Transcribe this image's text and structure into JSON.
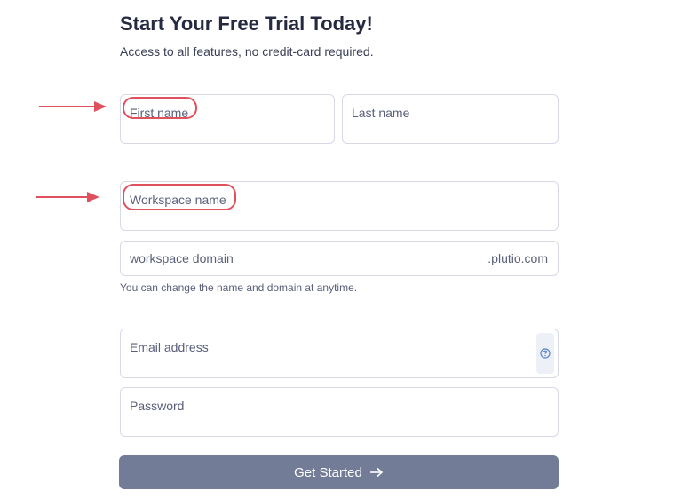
{
  "header": {
    "title": "Start Your Free Trial Today!",
    "subtitle": "Access to all features, no credit-card required."
  },
  "form": {
    "first_name_label": "First name",
    "last_name_label": "Last name",
    "workspace_name_label": "Workspace name",
    "workspace_domain_label": "workspace domain",
    "workspace_domain_suffix": ".plutio.com",
    "domain_hint": "You can change the name and domain at anytime.",
    "email_label": "Email address",
    "password_label": "Password",
    "submit_label": "Get Started"
  },
  "annotations": {
    "highlight_color": "#e0515e"
  },
  "colors": {
    "button_bg": "#737c96",
    "field_border": "#d7d9e6",
    "help_icon": "#5b86c9"
  }
}
